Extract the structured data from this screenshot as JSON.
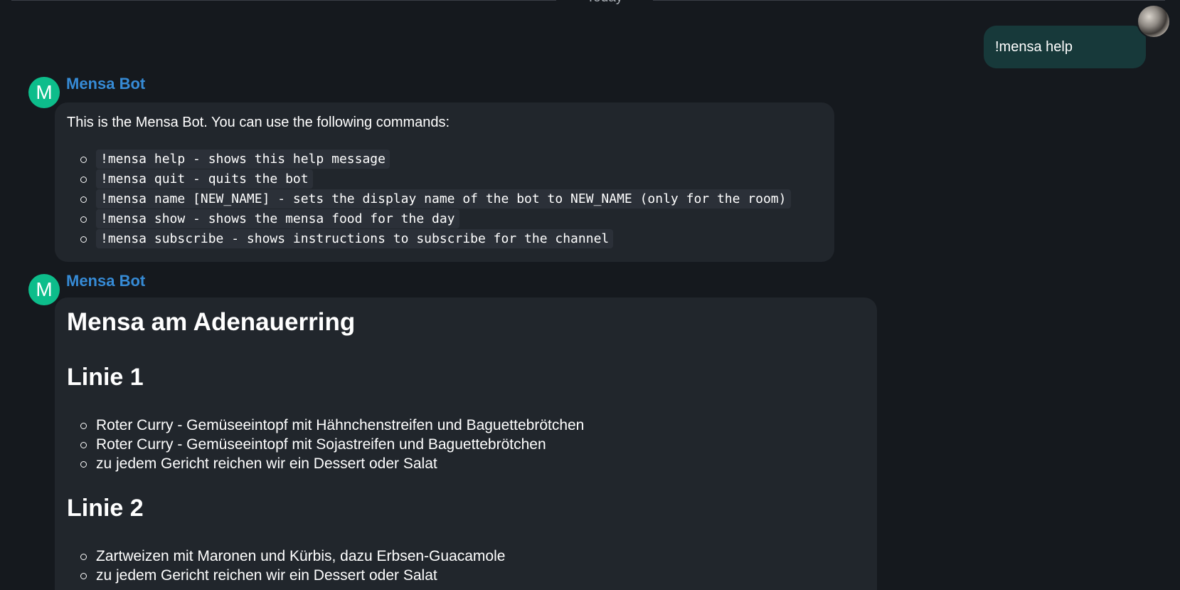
{
  "date_separator": "Today",
  "own_message": {
    "text": "!mensa help",
    "avatar_icon": "user-avatar-photo"
  },
  "messages": [
    {
      "sender": "Mensa Bot",
      "avatar_letter": "M",
      "intro": "This is the Mensa Bot. You can use the following commands:",
      "commands": [
        "!mensa help - shows this help message",
        "!mensa quit - quits the bot",
        "!mensa name [NEW_NAME] - sets the display name of the bot to NEW_NAME (only for the room)",
        "!mensa show - shows the mensa food for the day",
        "!mensa subscribe - shows instructions to subscribe for the channel"
      ]
    },
    {
      "sender": "Mensa Bot",
      "avatar_letter": "M",
      "title": "Mensa am Adenauerring",
      "lines": [
        {
          "heading": "Linie 1",
          "items": [
            "Roter Curry - Gemüseeintopf mit Hähnchenstreifen und Baguettebrötchen",
            "Roter Curry - Gemüseeintopf mit Sojastreifen und Baguettebrötchen",
            "zu jedem Gericht reichen wir ein Dessert oder Salat"
          ]
        },
        {
          "heading": "Linie 2",
          "items": [
            "Zartweizen mit Maronen und Kürbis, dazu Erbsen-Guacamole",
            "zu jedem Gericht reichen wir ein Dessert oder Salat"
          ]
        }
      ]
    }
  ],
  "colors": {
    "background": "#15191e",
    "bubble": "#21262c",
    "own_bubble": "#17393a",
    "sender_name": "#368bd6",
    "avatar": "#0dbd8b"
  }
}
